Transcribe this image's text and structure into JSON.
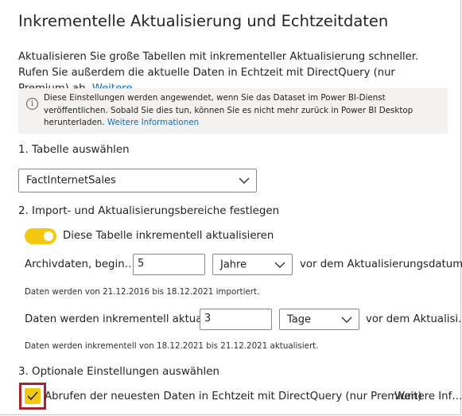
{
  "dialog": {
    "title": "Inkrementelle Aktualisierung und Echtzeitdaten",
    "description": "Aktualisieren Sie große Tabellen mit inkrementeller Aktualisierung schneller. Rufen Sie außerdem die aktuelle Daten in Echtzeit mit DirectQuery (nur Premium) ab.",
    "description_link": "Weitere…"
  },
  "info": {
    "icon": "info-icon",
    "text": "Diese Einstellungen werden angewendet, wenn Sie das Dataset im Power BI-Dienst veröffentlichen. Sobald Sie dies tun, können Sie es nicht mehr zurück in Power BI Desktop herunterladen.",
    "link": "Weitere Informationen"
  },
  "step1": {
    "heading": "1. Tabelle auswählen",
    "table_select_value": "FactInternetSales"
  },
  "step2": {
    "heading": "2. Import- und Aktualisierungsbereiche festlegen",
    "toggle_label": "Diese Tabelle inkrementell aktualisieren",
    "toggle_on": true,
    "archive_label": "Archivdaten, begin…",
    "archive_value": "5",
    "archive_unit": "Jahre",
    "archive_suffix": "vor dem Aktualisierungsdatum",
    "archive_note": "Daten werden von 21.12.2016 bis 18.12.2021 importiert.",
    "incremental_label": "Daten werden inkrementell aktua…",
    "incremental_value": "3",
    "incremental_unit": "Tage",
    "incremental_suffix": "vor dem Aktualisi…",
    "incremental_note": "Daten werden inkrementell von 18.12.2021 bis 21.12.2021 aktualisiert."
  },
  "step3": {
    "heading": "3. Optionale Einstellungen auswählen",
    "realtime_label": "Abrufen der neuesten Daten in Echtzeit mit DirectQuery (nur Premium)",
    "realtime_checked": true,
    "realtime_link": "Weitere Inf…"
  },
  "colors": {
    "accent_yellow": "#f2c811",
    "link_blue": "#106ebe",
    "highlight_red": "#a4262c",
    "info_bg": "#f3f2f1"
  }
}
